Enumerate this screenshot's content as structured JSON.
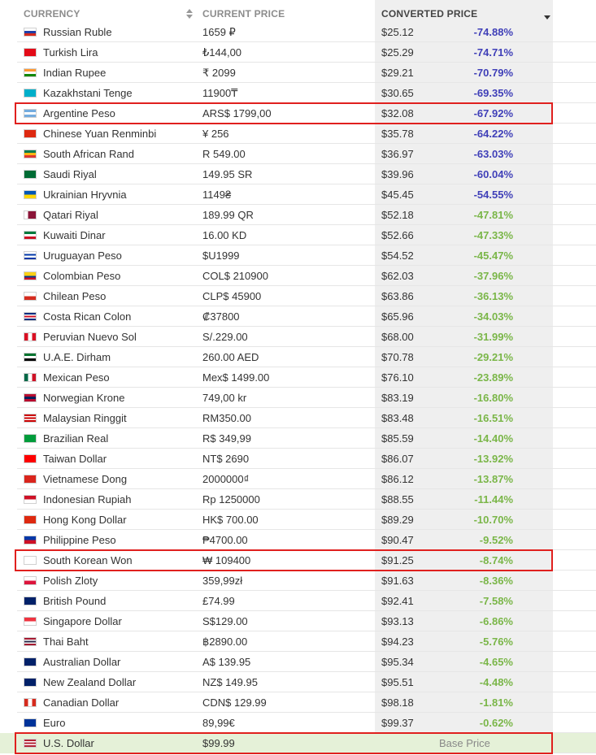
{
  "headers": {
    "currency": "CURRENCY",
    "current_price": "CURRENT PRICE",
    "converted_price": "CONVERTED PRICE"
  },
  "base_label": "Base Price",
  "colors": {
    "negative_strong": "#3f3fb8",
    "negative_mild": "#7ab648",
    "highlight": "#e0201e",
    "base_row": "#e5f1d8"
  },
  "rows": [
    {
      "name": "Russian Ruble",
      "price": "1659 ₽",
      "converted": "$25.12",
      "pct": "-74.88%",
      "color": "blue",
      "flag": [
        "#ffffff",
        "#1f3fa8",
        "#d52b1e"
      ],
      "dir": "h"
    },
    {
      "name": "Turkish Lira",
      "price": "₺144,00",
      "converted": "$25.29",
      "pct": "-74.71%",
      "color": "blue",
      "flag": [
        "#e30a17"
      ],
      "dir": "s"
    },
    {
      "name": "Indian Rupee",
      "price": "₹ 2099",
      "converted": "$29.21",
      "pct": "-70.79%",
      "color": "blue",
      "flag": [
        "#ff9933",
        "#ffffff",
        "#138808"
      ],
      "dir": "h"
    },
    {
      "name": "Kazakhstani Tenge",
      "price": "11900₸",
      "converted": "$30.65",
      "pct": "-69.35%",
      "color": "blue",
      "flag": [
        "#00afca"
      ],
      "dir": "s"
    },
    {
      "name": "Argentine Peso",
      "price": "ARS$ 1799,00",
      "converted": "$32.08",
      "pct": "-67.92%",
      "color": "blue",
      "flag": [
        "#74acdf",
        "#ffffff",
        "#74acdf"
      ],
      "dir": "h",
      "highlight": true
    },
    {
      "name": "Chinese Yuan Renminbi",
      "price": "¥ 256",
      "converted": "$35.78",
      "pct": "-64.22%",
      "color": "blue",
      "flag": [
        "#de2910"
      ],
      "dir": "s"
    },
    {
      "name": "South African Rand",
      "price": "R 549.00",
      "converted": "$36.97",
      "pct": "-63.03%",
      "color": "blue",
      "flag": [
        "#007a4d",
        "#ffb612",
        "#de3831"
      ],
      "dir": "h"
    },
    {
      "name": "Saudi Riyal",
      "price": "149.95 SR",
      "converted": "$39.96",
      "pct": "-60.04%",
      "color": "blue",
      "flag": [
        "#006c35"
      ],
      "dir": "s"
    },
    {
      "name": "Ukrainian Hryvnia",
      "price": "1149₴",
      "converted": "$45.45",
      "pct": "-54.55%",
      "color": "blue",
      "flag": [
        "#0057b7",
        "#ffd700"
      ],
      "dir": "h"
    },
    {
      "name": "Qatari Riyal",
      "price": "189.99 QR",
      "converted": "$52.18",
      "pct": "-47.81%",
      "color": "green",
      "flag": [
        "#ffffff",
        "#8a1538",
        "#8a1538"
      ],
      "dir": "v"
    },
    {
      "name": "Kuwaiti Dinar",
      "price": "16.00 KD",
      "converted": "$52.66",
      "pct": "-47.33%",
      "color": "green",
      "flag": [
        "#007a3d",
        "#ffffff",
        "#ce1126"
      ],
      "dir": "h"
    },
    {
      "name": "Uruguayan Peso",
      "price": "$U1999",
      "converted": "$54.52",
      "pct": "-45.47%",
      "color": "green",
      "flag": [
        "#ffffff",
        "#0038a8",
        "#ffffff",
        "#0038a8"
      ],
      "dir": "h"
    },
    {
      "name": "Colombian Peso",
      "price": "COL$ 210900",
      "converted": "$62.03",
      "pct": "-37.96%",
      "color": "green",
      "flag": [
        "#fcd116",
        "#fcd116",
        "#003893",
        "#ce1126"
      ],
      "dir": "h"
    },
    {
      "name": "Chilean Peso",
      "price": "CLP$ 45900",
      "converted": "$63.86",
      "pct": "-36.13%",
      "color": "green",
      "flag": [
        "#ffffff",
        "#d52b1e"
      ],
      "dir": "h"
    },
    {
      "name": "Costa Rican Colon",
      "price": "₡37800",
      "converted": "$65.96",
      "pct": "-34.03%",
      "color": "green",
      "flag": [
        "#002b7f",
        "#ffffff",
        "#ce1126",
        "#ffffff",
        "#002b7f"
      ],
      "dir": "h"
    },
    {
      "name": "Peruvian Nuevo Sol",
      "price": "S/.229.00",
      "converted": "$68.00",
      "pct": "-31.99%",
      "color": "green",
      "flag": [
        "#d91023",
        "#ffffff",
        "#d91023"
      ],
      "dir": "v"
    },
    {
      "name": "U.A.E. Dirham",
      "price": "260.00 AED",
      "converted": "$70.78",
      "pct": "-29.21%",
      "color": "green",
      "flag": [
        "#00732f",
        "#ffffff",
        "#000000"
      ],
      "dir": "h"
    },
    {
      "name": "Mexican Peso",
      "price": "Mex$ 1499.00",
      "converted": "$76.10",
      "pct": "-23.89%",
      "color": "green",
      "flag": [
        "#006847",
        "#ffffff",
        "#ce1126"
      ],
      "dir": "v"
    },
    {
      "name": "Norwegian Krone",
      "price": "749,00 kr",
      "converted": "$83.19",
      "pct": "-16.80%",
      "color": "green",
      "flag": [
        "#ba0c2f",
        "#00205b",
        "#ba0c2f"
      ],
      "dir": "h"
    },
    {
      "name": "Malaysian Ringgit",
      "price": "RM350.00",
      "converted": "$83.48",
      "pct": "-16.51%",
      "color": "green",
      "flag": [
        "#cc0001",
        "#ffffff",
        "#cc0001",
        "#ffffff",
        "#cc0001"
      ],
      "dir": "h"
    },
    {
      "name": "Brazilian Real",
      "price": "R$ 349,99",
      "converted": "$85.59",
      "pct": "-14.40%",
      "color": "green",
      "flag": [
        "#009c3b"
      ],
      "dir": "s"
    },
    {
      "name": "Taiwan Dollar",
      "price": "NT$ 2690",
      "converted": "$86.07",
      "pct": "-13.92%",
      "color": "green",
      "flag": [
        "#fe0000"
      ],
      "dir": "s"
    },
    {
      "name": "Vietnamese Dong",
      "price": "2000000₫",
      "converted": "$86.12",
      "pct": "-13.87%",
      "color": "green",
      "flag": [
        "#da251d"
      ],
      "dir": "s"
    },
    {
      "name": "Indonesian Rupiah",
      "price": "Rp 1250000",
      "converted": "$88.55",
      "pct": "-11.44%",
      "color": "green",
      "flag": [
        "#ce1126",
        "#ffffff"
      ],
      "dir": "h"
    },
    {
      "name": "Hong Kong Dollar",
      "price": "HK$ 700.00",
      "converted": "$89.29",
      "pct": "-10.70%",
      "color": "green",
      "flag": [
        "#de2910"
      ],
      "dir": "s"
    },
    {
      "name": "Philippine Peso",
      "price": "₱4700.00",
      "converted": "$90.47",
      "pct": "-9.52%",
      "color": "green",
      "flag": [
        "#0038a8",
        "#ce1126"
      ],
      "dir": "h"
    },
    {
      "name": "South Korean Won",
      "price": "₩ 109400",
      "converted": "$91.25",
      "pct": "-8.74%",
      "color": "green",
      "flag": [
        "#ffffff"
      ],
      "dir": "s",
      "highlight": true
    },
    {
      "name": "Polish Zloty",
      "price": "359,99zł",
      "converted": "$91.63",
      "pct": "-8.36%",
      "color": "green",
      "flag": [
        "#ffffff",
        "#dc143c"
      ],
      "dir": "h"
    },
    {
      "name": "British Pound",
      "price": "£74.99",
      "converted": "$92.41",
      "pct": "-7.58%",
      "color": "green",
      "flag": [
        "#012169"
      ],
      "dir": "s"
    },
    {
      "name": "Singapore Dollar",
      "price": "S$129.00",
      "converted": "$93.13",
      "pct": "-6.86%",
      "color": "green",
      "flag": [
        "#ef3340",
        "#ffffff"
      ],
      "dir": "h"
    },
    {
      "name": "Thai Baht",
      "price": "฿2890.00",
      "converted": "$94.23",
      "pct": "-5.76%",
      "color": "green",
      "flag": [
        "#a51931",
        "#ffffff",
        "#2d2a4a",
        "#ffffff",
        "#a51931"
      ],
      "dir": "h"
    },
    {
      "name": "Australian Dollar",
      "price": "A$ 139.95",
      "converted": "$95.34",
      "pct": "-4.65%",
      "color": "green",
      "flag": [
        "#012169"
      ],
      "dir": "s"
    },
    {
      "name": "New Zealand Dollar",
      "price": "NZ$ 149.95",
      "converted": "$95.51",
      "pct": "-4.48%",
      "color": "green",
      "flag": [
        "#012169"
      ],
      "dir": "s"
    },
    {
      "name": "Canadian Dollar",
      "price": "CDN$ 129.99",
      "converted": "$98.18",
      "pct": "-1.81%",
      "color": "green",
      "flag": [
        "#d52b1e",
        "#ffffff",
        "#d52b1e"
      ],
      "dir": "v"
    },
    {
      "name": "Euro",
      "price": "89,99€",
      "converted": "$99.37",
      "pct": "-0.62%",
      "color": "green",
      "flag": [
        "#003399"
      ],
      "dir": "s"
    },
    {
      "name": "U.S. Dollar",
      "price": "$99.99",
      "converted": "",
      "pct": "",
      "color": "",
      "flag": [
        "#b22234",
        "#ffffff",
        "#b22234",
        "#ffffff",
        "#b22234"
      ],
      "dir": "h",
      "highlight": true,
      "base": true
    }
  ]
}
